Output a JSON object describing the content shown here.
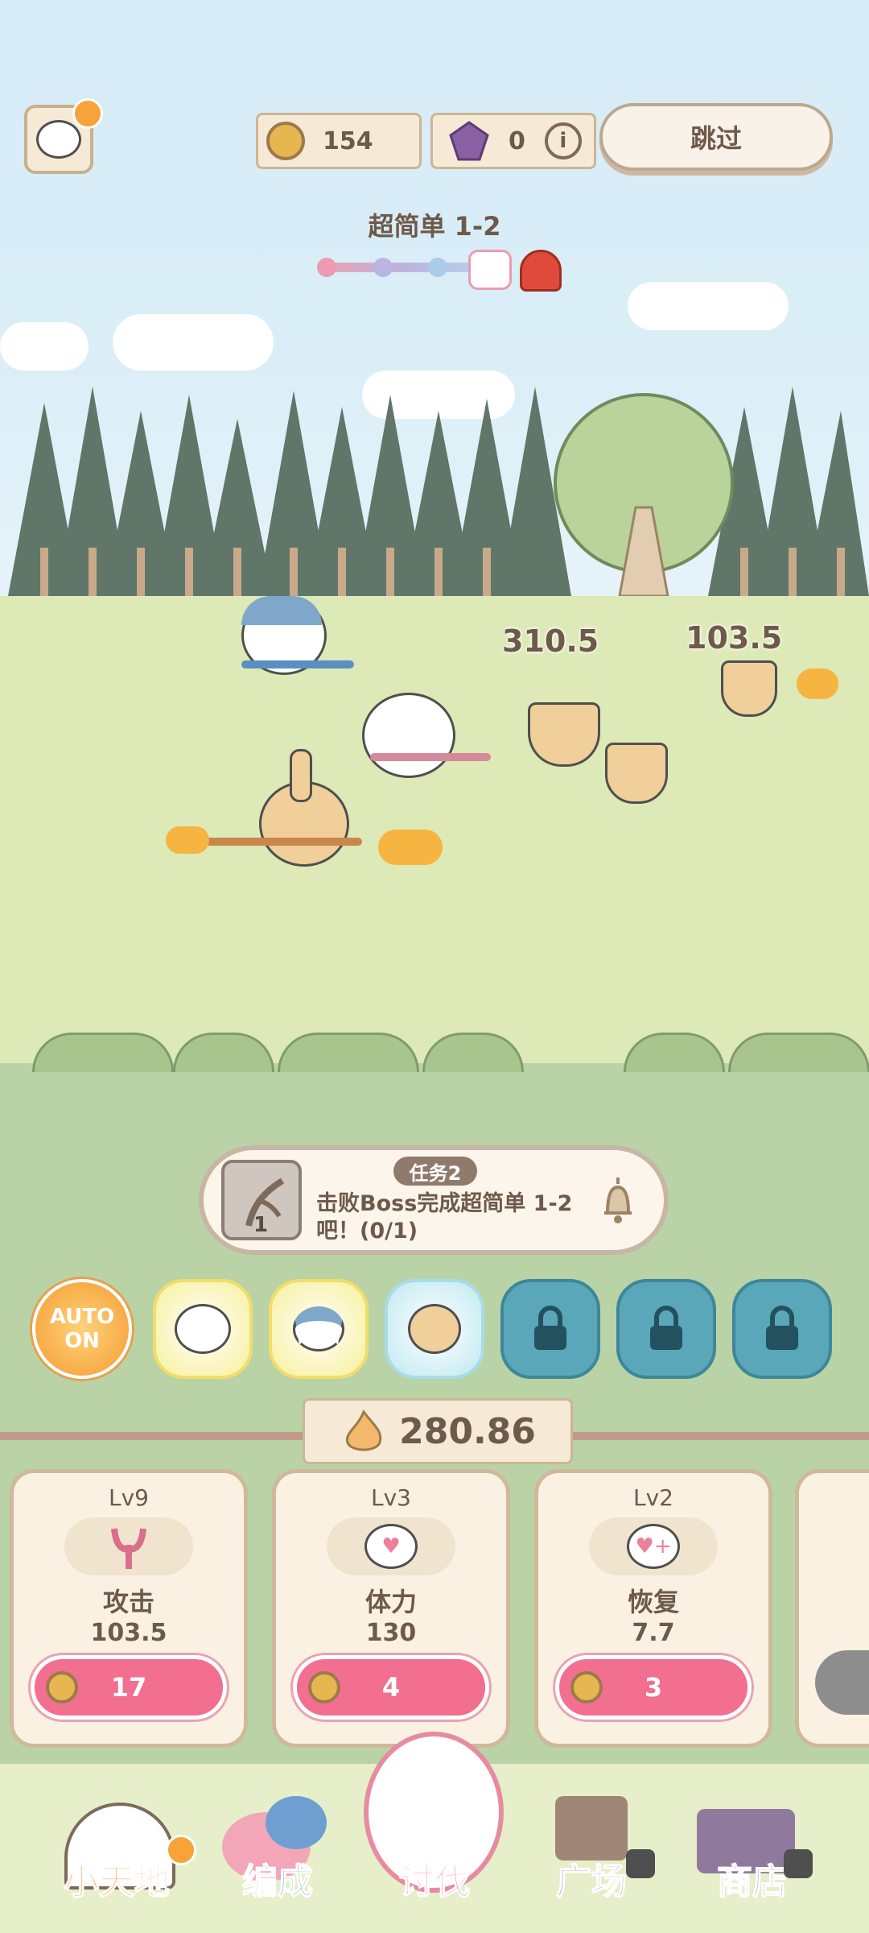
{
  "top_bar": {
    "coins": "154",
    "gems": "0",
    "skip_label": "跳过"
  },
  "stage": {
    "title": "超简单 1-2"
  },
  "battle": {
    "damage_numbers": [
      "310.5",
      "103.5"
    ]
  },
  "task": {
    "badge": "任务2",
    "item_count": "1",
    "description": "击败Boss完成超简单 1-2吧！(0/1)"
  },
  "auto_button": {
    "line1": "AUTO",
    "line2": "ON"
  },
  "power": {
    "value": "280.86"
  },
  "upgrade_cards": [
    {
      "level": "Lv9",
      "name": "攻击",
      "value": "103.5",
      "cost": "17"
    },
    {
      "level": "Lv3",
      "name": "体力",
      "value": "130",
      "cost": "4"
    },
    {
      "level": "Lv2",
      "name": "恢复",
      "value": "7.7",
      "cost": "3"
    }
  ],
  "nav": {
    "items": [
      "小天地",
      "编成",
      "讨伐",
      "广场",
      "商店"
    ]
  },
  "colors": {
    "accent_pink": "#f26f8f",
    "nav_text": "#ff9a3c",
    "wood": "#cdb594"
  }
}
